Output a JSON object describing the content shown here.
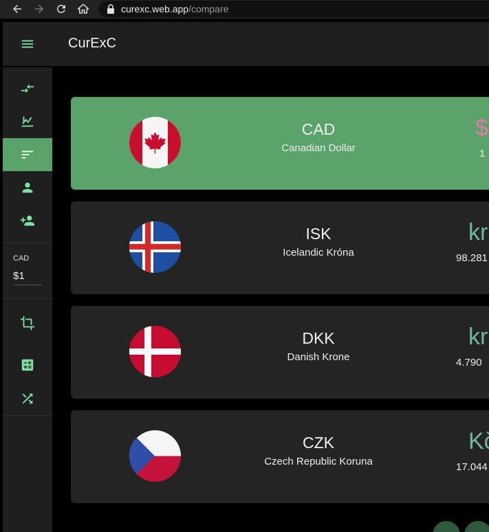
{
  "browser": {
    "url_host": "curexc.web.app",
    "url_path": "/compare"
  },
  "header": {
    "title": "CurExC"
  },
  "sidebar": {
    "items": [
      {
        "icon": "compare-arrows-icon"
      },
      {
        "icon": "chart-icon"
      },
      {
        "icon": "sort-icon",
        "active": true
      },
      {
        "icon": "person-icon"
      },
      {
        "icon": "person-add-icon"
      },
      {
        "icon": "crop-icon"
      },
      {
        "icon": "calculator-icon"
      },
      {
        "icon": "shuffle-icon"
      }
    ],
    "base_currency": {
      "label": "CAD",
      "value": "$1"
    }
  },
  "cards": [
    {
      "code": "CAD",
      "name": "Canadian Dollar",
      "symbol": "$",
      "amount": "1",
      "flag": "canada-flag-icon",
      "is_base": true
    },
    {
      "code": "ISK",
      "name": "Icelandic Króna",
      "symbol": "kr",
      "amount": "98.281",
      "flag": "iceland-flag-icon"
    },
    {
      "code": "DKK",
      "name": "Danish Krone",
      "symbol": "kr",
      "amount": "4.790",
      "flag": "denmark-flag-icon"
    },
    {
      "code": "CZK",
      "name": "Czech Republic Koruna",
      "symbol": "Kč",
      "amount": "17.044",
      "flag": "czech-flag-icon"
    }
  ],
  "colors": {
    "accent": "#5aa36b",
    "icon": "#7ee3a0",
    "card_bg": "#242424",
    "symbol": "#6fb8a2",
    "base_symbol": "#e27ca2"
  }
}
